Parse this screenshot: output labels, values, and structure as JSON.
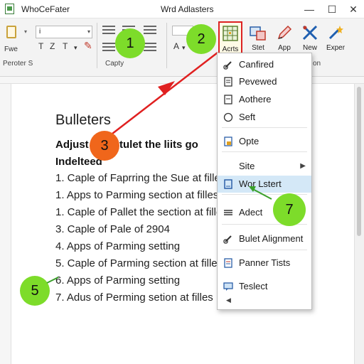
{
  "titlebar": {
    "app_title": "WhoCeFater",
    "window_title": "Wrd Adlasters",
    "minimize": "—",
    "maximize": "☐",
    "close": "✕"
  },
  "ribbon": {
    "file_label": "Fwe",
    "font_combo_value": "i",
    "group_left_label": "Peroter S",
    "group_mid_label": "Capty",
    "group_right_label": "on",
    "format_buttons": [
      "T",
      "Z",
      "T"
    ],
    "font_color_label": "A",
    "buttons": [
      {
        "label": "Acrts",
        "icon": "bullets-grid-icon"
      },
      {
        "label": "Stet",
        "icon": "chart-icon"
      },
      {
        "label": "App",
        "icon": "pen-icon"
      },
      {
        "label": "New",
        "icon": "tools-icon"
      },
      {
        "label": "Exper",
        "icon": "wand-icon"
      }
    ]
  },
  "document": {
    "title": "Bulleters",
    "subtitle": "Adjust    contulet the liits go",
    "subtitle2": "Indeltеed",
    "list": [
      "1. Caple of Faprring the Sue at filles",
      "1. Apps to Parming section at filles",
      "1. Caple of Pallet the section at filles",
      "3. Caple of Pale of 2904",
      "4. Apps of Parming setting",
      "5. Caple of Parming section at filles",
      "6. Apps of Parming setting",
      "7. Adus of Perming setion at filles"
    ]
  },
  "menu": {
    "items": [
      {
        "label": "Canfired",
        "icon": "link-icon"
      },
      {
        "label": "Pevewed",
        "icon": "document-icon"
      },
      {
        "label": "Aothere",
        "icon": "document-icon"
      },
      {
        "label": "Seft",
        "icon": "circle-icon"
      },
      {
        "label": "Opte",
        "icon": "options-icon"
      },
      {
        "label": "Site",
        "icon": "",
        "submenu": true
      },
      {
        "label": "Wor Lstert",
        "icon": "document-icon",
        "selected": true
      },
      {
        "label": "Adect",
        "icon": "list-icon"
      },
      {
        "label": "Bulet Alignment",
        "icon": "link-icon"
      },
      {
        "label": "Panner Tists",
        "icon": "list-icon"
      },
      {
        "label": "Teslect",
        "icon": "comment-icon"
      }
    ],
    "submenu_arrow": "▶",
    "scroll_arrow": "◀"
  },
  "callouts": {
    "c1": "1",
    "c2": "2",
    "c3": "3",
    "c5": "5",
    "c7": "7"
  },
  "colors": {
    "callout_green": "#7ddc2a",
    "callout_orange": "#f0661b",
    "arrow_red": "#e02020",
    "menu_selected": "#d4e8f7"
  }
}
